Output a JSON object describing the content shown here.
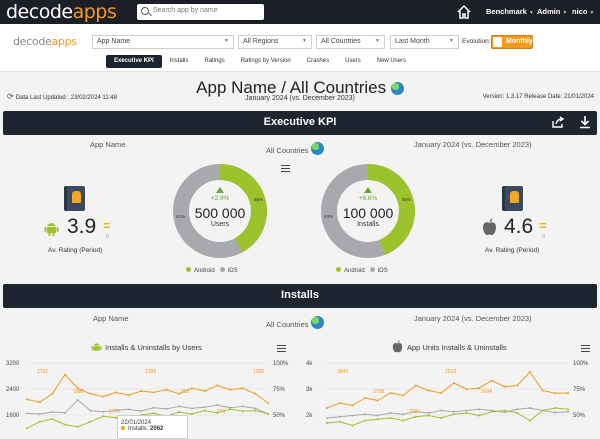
{
  "header": {
    "logo_left": "decode",
    "logo_right": "apps",
    "search_placeholder": "Search app by name",
    "nav": [
      {
        "label": "Benchmark"
      },
      {
        "label": "Admin"
      },
      {
        "label": "nico"
      }
    ]
  },
  "filters": {
    "logo_left": "decode",
    "logo_right": "apps",
    "app": "App Name",
    "region": "All Regions",
    "country": "All Countries",
    "period": "Last Month",
    "evolution_label": "Evolution:",
    "evolution_value": "Monthly"
  },
  "tabs": [
    "Executive KPI",
    "Installs",
    "Ratings",
    "Ratings by Version",
    "Crashes",
    "Users",
    "New Users"
  ],
  "page": {
    "updated": "Data Last Updated : 23/02/2024 11:48",
    "title": "App Name / All Countries",
    "subtitle": "January 2024 (vs. December 2023)",
    "version": "Version: 1.3.17 Release Date: 21/01/2024"
  },
  "exec": {
    "bar_title": "Executive KPI",
    "app": "App Name",
    "countries": "All Countries",
    "period": "January 2024 (vs. December 2023)",
    "android_rating": "3.9",
    "android_rating_change": "0",
    "ios_rating": "4.6",
    "ios_rating_change": "0",
    "rating_label": "Av. Rating (Period)",
    "users": {
      "delta": "+2.9%",
      "value": "500 000",
      "unit": "Users",
      "android_pct": "42%",
      "ios_pct": "58%",
      "android_share": 0.42
    },
    "installs": {
      "delta": "+6.6%",
      "value": "100 000",
      "unit": "Installs",
      "android_pct": "44%",
      "ios_pct": "56%",
      "android_share": 0.44
    },
    "legend_android": "Android",
    "legend_ios": "iOS",
    "colors": {
      "android": "#9cc32c",
      "ios": "#a7a9ac",
      "accent": "#f39a1e",
      "bar": "#1f2431"
    }
  },
  "installs": {
    "bar_title": "Installs",
    "app": "App Name",
    "countries": "All Countries",
    "period": "January 2024 (vs. December 2023)",
    "left_title": "Installs & Uninstalls by Users",
    "right_title": "App Units Installs & Uninstalls",
    "tooltip_date": "22/01/2024",
    "tooltip_label": "Installs:",
    "tooltip_value": "2062"
  },
  "chart_data": [
    {
      "type": "line",
      "title": "Installs & Uninstalls by Users",
      "y_ticks_left": [
        "3200",
        "2400",
        "1600"
      ],
      "y_ticks_right": [
        "100%",
        "75%",
        "50%"
      ],
      "labels": [
        "2791",
        "1880",
        "1772",
        "1386",
        "925",
        "870",
        "1385"
      ],
      "series": [
        {
          "color": "#f39a1e",
          "values": [
            1900,
            1800,
            2100,
            2791,
            2300,
            2100,
            2000,
            2150,
            2050,
            2200,
            2150,
            2250,
            2100,
            2300,
            2200,
            2400,
            2250,
            2300,
            2100,
            1772
          ]
        },
        {
          "color": "#a7a9ac",
          "values": [
            1400,
            1380,
            1450,
            1420,
            1880,
            1500,
            1460,
            1500,
            1550,
            1480,
            1600,
            1560,
            1650,
            1580,
            1620,
            1700,
            1600,
            1650,
            1580,
            1386
          ]
        },
        {
          "color": "#9cc32c",
          "values": [
            870,
            1100,
            1200,
            1000,
            925,
            1100,
            1300,
            1250,
            1150,
            1350,
            1400,
            1300,
            1450,
            1380,
            1500,
            1420,
            1550,
            1480,
            1500,
            1385
          ]
        }
      ]
    },
    {
      "type": "line",
      "title": "App Units Installs & Uninstalls",
      "y_ticks_left": [
        "4k",
        "3k",
        "2k"
      ],
      "y_ticks_right": [
        "100%",
        "75%",
        "50%"
      ],
      "labels": [
        "3643",
        "2788",
        "2030",
        "2018",
        "1694"
      ],
      "series": [
        {
          "color": "#f39a1e",
          "values": [
            2200,
            2400,
            2300,
            2600,
            2500,
            2800,
            2700,
            3100,
            2900,
            2800,
            3200,
            2950,
            3000,
            3300,
            3050,
            3100,
            3643,
            2900,
            2788,
            2800
          ]
        },
        {
          "color": "#a7a9ac",
          "values": [
            1800,
            1850,
            1900,
            1950,
            1900,
            2000,
            1950,
            2050,
            2000,
            2100,
            2050,
            2100,
            2150,
            2100,
            2030,
            2150,
            2200,
            2100,
            2018,
            2050
          ]
        },
        {
          "color": "#9cc32c",
          "values": [
            1600,
            1650,
            1500,
            1700,
            1750,
            1800,
            1700,
            1850,
            1900,
            1800,
            1950,
            2000,
            1900,
            2050,
            2100,
            2000,
            1694,
            2100,
            2200,
            2150
          ]
        }
      ]
    }
  ]
}
